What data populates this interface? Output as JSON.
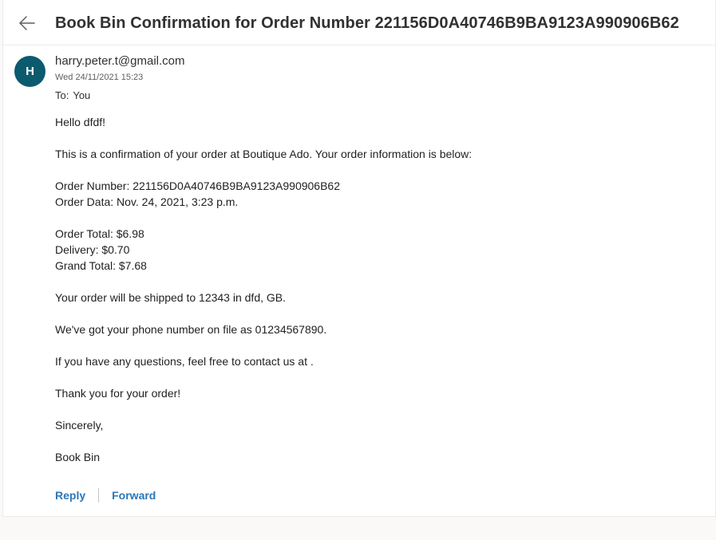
{
  "header": {
    "back_icon": "arrow-left-icon",
    "subject": "Book Bin Confirmation for Order Number 221156D0A40746B9BA9123A990906B62"
  },
  "sender": {
    "avatar_initial": "H",
    "avatar_color": "#0b5a6e",
    "email": "harry.peter.t@gmail.com",
    "date": "Wed 24/11/2021 15:23",
    "to_label": "To:",
    "to_value": "You"
  },
  "message": {
    "greeting": "Hello dfdf!",
    "intro": "This is a confirmation of your order at Boutique Ado. Your order information is below:",
    "order_number": "Order Number: 221156D0A40746B9BA9123A990906B62",
    "order_date": "Order Data: Nov. 24, 2021, 3:23 p.m.",
    "order_total": "Order Total: $6.98",
    "delivery": "Delivery: $0.70",
    "grand_total": "Grand Total: $7.68",
    "shipping": "Your order will be shipped to 12343 in dfd, GB.",
    "phone": "We've got your phone number on file as 01234567890.",
    "questions": "If you have any questions, feel free to contact us at .",
    "thanks": "Thank you for your order!",
    "signoff": "Sincerely,",
    "signature": "Book Bin"
  },
  "actions": {
    "reply_label": "Reply",
    "forward_label": "Forward",
    "link_color": "#2b76b9"
  }
}
